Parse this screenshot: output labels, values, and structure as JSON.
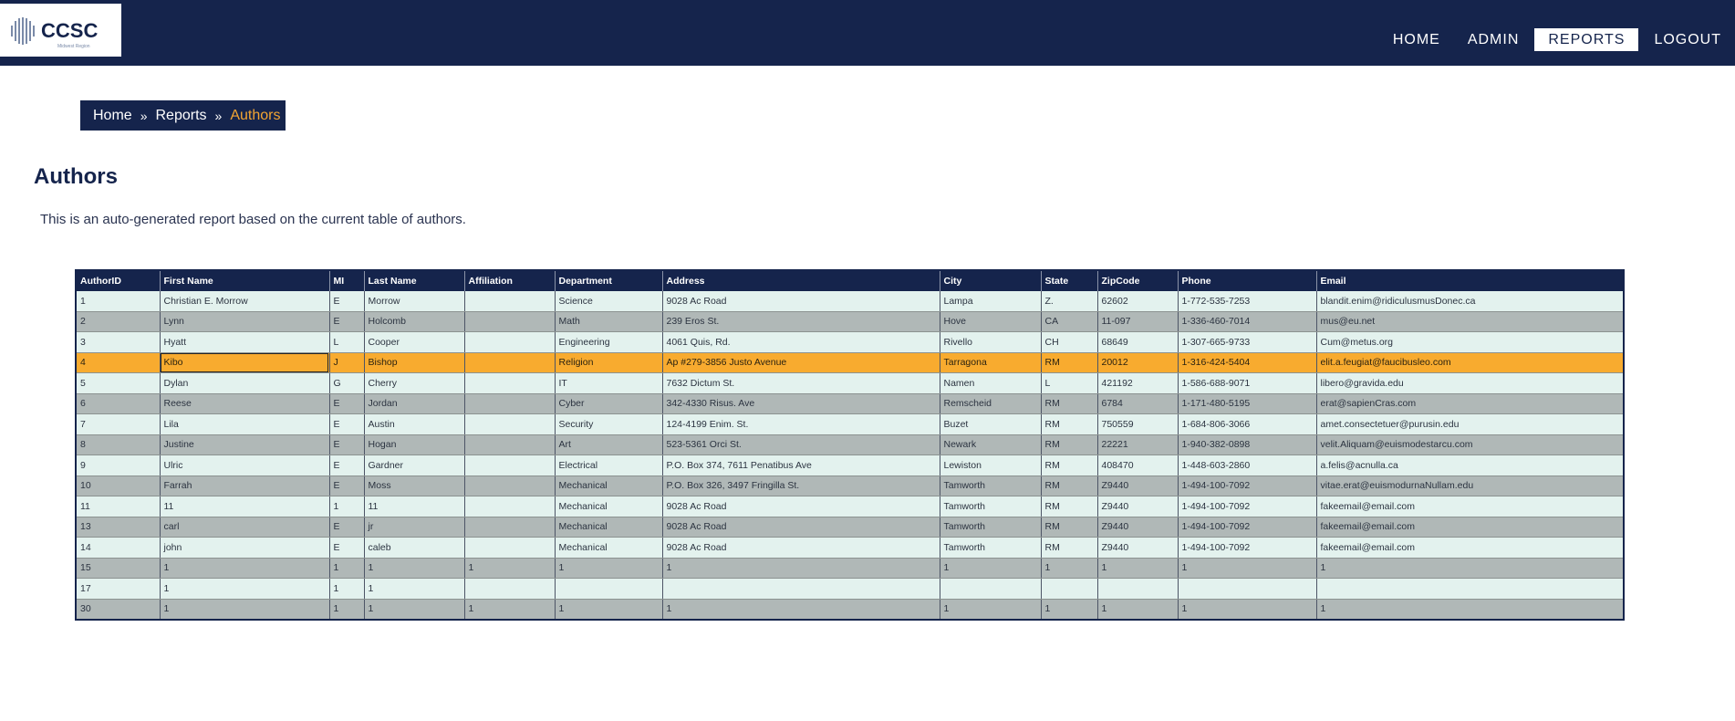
{
  "header": {
    "logo_text": "CCSC",
    "logo_subtext": "Midwest Region",
    "nav": [
      {
        "label": "HOME",
        "active": false
      },
      {
        "label": "ADMIN",
        "active": false
      },
      {
        "label": "REPORTS",
        "active": true
      },
      {
        "label": "LOGOUT",
        "active": false
      }
    ]
  },
  "breadcrumb": {
    "items": [
      "Home",
      "Reports",
      "Authors"
    ],
    "separator": "»"
  },
  "page": {
    "title": "Authors",
    "description": "This is an auto-generated report based on the current table of authors."
  },
  "table": {
    "columns": [
      "AuthorID",
      "First Name",
      "MI",
      "Last Name",
      "Affiliation",
      "Department",
      "Address",
      "City",
      "State",
      "ZipCode",
      "Phone",
      "Email"
    ],
    "highlight_row": 3,
    "rows": [
      [
        "1",
        "Christian E. Morrow",
        "E",
        "Morrow",
        "",
        "Science",
        "9028 Ac Road",
        "Lampa",
        "Z.",
        "62602",
        "1-772-535-7253",
        "blandit.enim@ridiculusmusDonec.ca"
      ],
      [
        "2",
        "Lynn",
        "E",
        "Holcomb",
        "",
        "Math",
        "239 Eros St.",
        "Hove",
        "CA",
        "11-097",
        "1-336-460-7014",
        "mus@eu.net"
      ],
      [
        "3",
        "Hyatt",
        "L",
        "Cooper",
        "",
        "Engineering",
        "4061 Quis, Rd.",
        "Rivello",
        "CH",
        "68649",
        "1-307-665-9733",
        "Cum@metus.org"
      ],
      [
        "4",
        "Kibo",
        "J",
        "Bishop",
        "",
        "Religion",
        "Ap #279-3856 Justo Avenue",
        "Tarragona",
        "RM",
        "20012",
        "1-316-424-5404",
        "elit.a.feugiat@faucibusleo.com"
      ],
      [
        "5",
        "Dylan",
        "G",
        "Cherry",
        "",
        "IT",
        "7632 Dictum St.",
        "Namen",
        "L",
        "421192",
        "1-586-688-9071",
        "libero@gravida.edu"
      ],
      [
        "6",
        "Reese",
        "E",
        "Jordan",
        "",
        "Cyber",
        "342-4330 Risus. Ave",
        "Remscheid",
        "RM",
        "6784",
        "1-171-480-5195",
        "erat@sapienCras.com"
      ],
      [
        "7",
        "Lila",
        "E",
        "Austin",
        "",
        "Security",
        "124-4199 Enim. St.",
        "Buzet",
        "RM",
        "750559",
        "1-684-806-3066",
        "amet.consectetuer@purusin.edu"
      ],
      [
        "8",
        "Justine",
        "E",
        "Hogan",
        "",
        "Art",
        "523-5361 Orci St.",
        "Newark",
        "RM",
        "22221",
        "1-940-382-0898",
        "velit.Aliquam@euismodestarcu.com"
      ],
      [
        "9",
        "Ulric",
        "E",
        "Gardner",
        "",
        "Electrical",
        "P.O. Box 374, 7611 Penatibus Ave",
        "Lewiston",
        "RM",
        "408470",
        "1-448-603-2860",
        "a.felis@acnulla.ca"
      ],
      [
        "10",
        "Farrah",
        "E",
        "Moss",
        "",
        "Mechanical",
        "P.O. Box 326, 3497 Fringilla St.",
        "Tamworth",
        "RM",
        "Z9440",
        "1-494-100-7092",
        "vitae.erat@euismodurnaNullam.edu"
      ],
      [
        "11",
        "11",
        "1",
        "11",
        "",
        "Mechanical",
        "9028 Ac Road",
        "Tamworth",
        "RM",
        "Z9440",
        "1-494-100-7092",
        "fakeemail@email.com"
      ],
      [
        "13",
        "carl",
        "E",
        "jr",
        "",
        "Mechanical",
        "9028 Ac Road",
        "Tamworth",
        "RM",
        "Z9440",
        "1-494-100-7092",
        "fakeemail@email.com"
      ],
      [
        "14",
        "john",
        "E",
        "caleb",
        "",
        "Mechanical",
        "9028 Ac Road",
        "Tamworth",
        "RM",
        "Z9440",
        "1-494-100-7092",
        "fakeemail@email.com"
      ],
      [
        "15",
        "1",
        "1",
        "1",
        "1",
        "1",
        "1",
        "1",
        "1",
        "1",
        "1",
        "1"
      ],
      [
        "17",
        "1",
        "1",
        "1",
        "",
        "",
        "",
        "",
        "",
        "",
        "",
        ""
      ],
      [
        "30",
        "1",
        "1",
        "1",
        "1",
        "1",
        "1",
        "1",
        "1",
        "1",
        "1",
        "1"
      ]
    ]
  },
  "colors": {
    "navy": "#15244c",
    "accent": "#f3a532",
    "row_light": "#e3f2ee",
    "row_dark": "#b0b8b7",
    "row_highlight": "#f8ab2f"
  }
}
